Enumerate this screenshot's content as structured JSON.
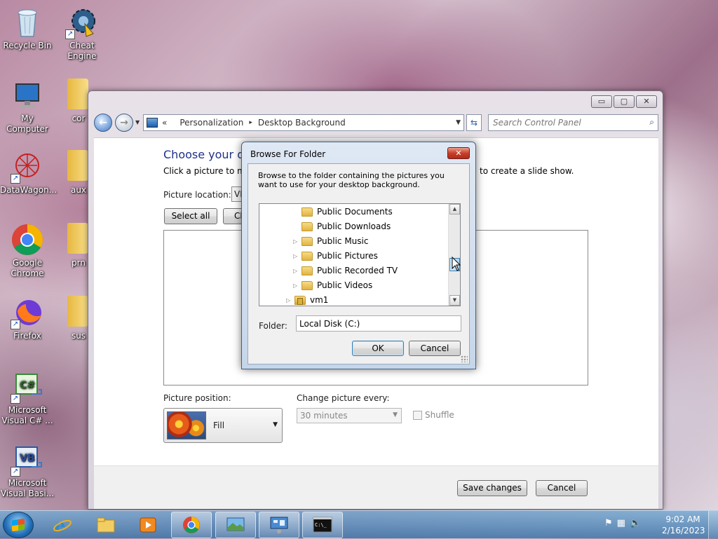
{
  "desktop": {
    "icons": [
      {
        "label": "Recycle Bin"
      },
      {
        "label": "Cheat Engine"
      },
      {
        "label": "My Computer"
      },
      {
        "label": "cor"
      },
      {
        "label": "DataWagon..."
      },
      {
        "label": "aux"
      },
      {
        "label": "Google Chrome"
      },
      {
        "label": "prn"
      },
      {
        "label": "Firefox"
      },
      {
        "label": "sus"
      },
      {
        "label": "Microsoft Visual C# ..."
      },
      {
        "label": "Microsoft Visual Basi..."
      }
    ]
  },
  "window": {
    "controls": {
      "minimize": "▭",
      "maximize": "▢",
      "close": "✕"
    },
    "address": {
      "prefix": "«",
      "crumb1": "Personalization",
      "separator": "▸",
      "crumb2": "Desktop Background"
    },
    "search_placeholder": "Search Control Panel",
    "heading": "Choose your des",
    "description_start": "Click a picture to mak",
    "description_end": "to create a slide show.",
    "picture_location_label": "Picture location:",
    "picture_location_value": "VM",
    "select_all_label": "Select all",
    "clear_all_label": "Cl",
    "picture_position_label": "Picture position:",
    "picture_position_value": "Fill",
    "change_picture_label": "Change picture every:",
    "change_picture_value": "30 minutes",
    "shuffle_label": "Shuffle",
    "save_label": "Save changes",
    "cancel_label": "Cancel"
  },
  "dialog": {
    "title": "Browse For Folder",
    "close": "✕",
    "description": "Browse to the folder containing the pictures you want to use for your desktop background.",
    "tree": [
      {
        "label": "Public Documents",
        "expandable": false
      },
      {
        "label": "Public Downloads",
        "expandable": false
      },
      {
        "label": "Public Music",
        "expandable": true
      },
      {
        "label": "Public Pictures",
        "expandable": true
      },
      {
        "label": "Public Recorded TV",
        "expandable": true
      },
      {
        "label": "Public Videos",
        "expandable": true
      },
      {
        "label": "vm1",
        "expandable": true
      }
    ],
    "folder_label": "Folder:",
    "folder_value": "Local Disk (C:)",
    "ok_label": "OK",
    "cancel_label": "Cancel"
  },
  "taskbar": {
    "items": [
      "internet-explorer",
      "file-explorer",
      "media-player",
      "google-chrome",
      "personalization",
      "control-panel",
      "command-prompt"
    ],
    "time": "9:02 AM",
    "date": "2/16/2023"
  }
}
